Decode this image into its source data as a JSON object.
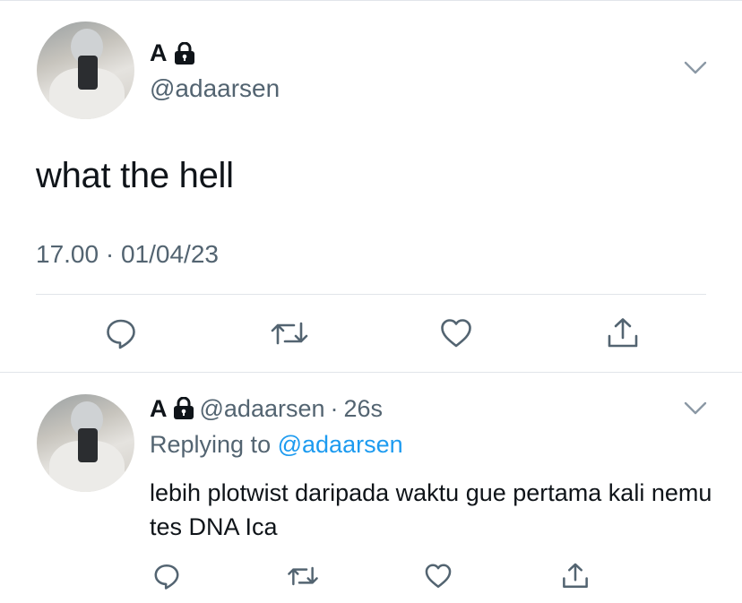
{
  "main_tweet": {
    "name": "A",
    "handle": "@adaarsen",
    "text": "what the hell",
    "time": "17.00",
    "date": "01/04/23",
    "separator": "·"
  },
  "reply_tweet": {
    "name": "A",
    "handle": "@adaarsen",
    "separator": "·",
    "age": "26s",
    "replying_prefix": "Replying to",
    "replying_to": "@adaarsen",
    "text": "lebih plotwist daripada waktu gue pertama kali nemu tes DNA Ica"
  },
  "icons": [
    "lock-icon",
    "chevron-down-icon",
    "reply-icon",
    "retweet-icon",
    "like-icon",
    "share-icon"
  ],
  "colors": {
    "text": "#0f1419",
    "secondary": "#536471",
    "accent": "#1d9bf0",
    "divider": "#e1e5ea"
  }
}
